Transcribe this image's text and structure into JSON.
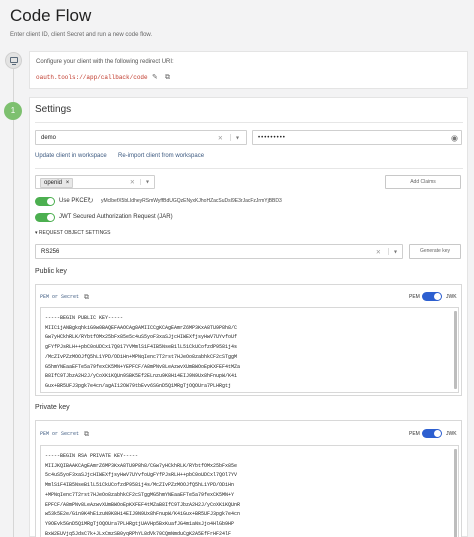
{
  "page": {
    "title": "Code Flow",
    "subtitle": "Enter client ID, client Secret and run a new code flow."
  },
  "redirect": {
    "label": "Configure your client with the following redirect URI:",
    "uri": "oauth.tools://app/callback/code"
  },
  "step2": {
    "number": "1"
  },
  "settings": {
    "title": "Settings",
    "client_id": "demo",
    "client_secret_masked": "•••••••••",
    "update_link": "Update client in workspace",
    "reimport_link": "Re-import client from workspace",
    "scope_chip": "openid",
    "add_claims_label": "Add Claims",
    "use_pkce_label": "Use PKCE",
    "pkce_value": "yMclbefX5bLIdheyRSmWyffBdUGQzENyxKJhoHZacSuDsI9E3rJacFzJrmYjBBD3",
    "jar_label": "JWT Secured Authorization Request (JAR)",
    "request_object_settings": "REQUEST OBJECT SETTINGS",
    "algorithm": "RS256",
    "generate_key_label": "Generate key"
  },
  "public_key": {
    "label": "Public key",
    "format_label": "PEM or Secret",
    "pem_label": "PEM",
    "jwk_label": "JWK",
    "lines": [
      "-----BEGIN PUBLIC KEY-----",
      "MIIC1jANBgkqhkiG9w0BAQEFAAOCAg8AMIICCgKCAgEAmrZ6MP3KxA8TU9P8h8/C",
      "Gw7yHCkhRLK/RYbtfOMx25bFx85e5c4uS5yoF3xaSJjcHIWEXfjsyHwV7UYvfoUf",
      "gFYfPJsRLH++pbC0oUDCx17Q017YVMmlS1F4IB5NseB1lL51CkUCofzdP9581j4s",
      "/McZIvPZzMOOJfQ5hL1YPD/ODiHn+MPNqIenc7T2rst7HJeOo8zabhkCF2cSTggM",
      "G5hmYNEaaEFTe5a79fexCK5MN+YEPFCF/A8mPNv8LeAzwvXUmBWOoEpKXFEF4tMZa",
      "B8IfC9TJbzA2H2J/yCoXK1KQUn9SBK5Ef2ELnzu9K8Hi4EIJ9N9Ux8hFnupW/K4i",
      "Gux+BR5UFJ3pgk7e4cn/agAI12OW79tbEvv6SGnD5Q1MRgTjOQOUra7PLHRgtj",
      "AVHp5BxKuafJG4m1aNsJjo4HlGb9HP5Bxw2EUVjq5JdsC7k+JLxCmzSB0yqRPhYL",
      "8dVk70CQmNmduCgK2A5EfFrHF24lF+TAAn1e/Ks3/TK3NrFV1MEGS3fHqJBaQFDH"
    ]
  },
  "private_key": {
    "label": "Private key",
    "format_label": "PEM or Secret",
    "pem_label": "PEM",
    "jwk_label": "JWK",
    "lines": [
      "-----BEGIN RSA PRIVATE KEY-----",
      "MIIJKQIBAAKCAgEAmrZ6MP3KxA8TU9P8h8/CGw7yHCkhRLK/RYbtfOMx25bFx85e",
      "5c4uS5yoF3xaSJjcHIWEXfjsyHwV7UYvfoUgFYfPJsRLH++pbC0oUDCxl7QOl7YV",
      "MmlS1F4IB5NseB1lL51CkUCofzdP9581j4s/McZIvPZzMOOJfQ5hL1YPD/ODiHn",
      "+MPNqIenc7T2rst7HJeOo8zabhkCF2cSTggMG5hmYNEaaEFTe5a79fexCK5MN+Y",
      "EPFCF/A8mPNv8LeAzwvXUmBWOoEpKXFEF4tMZaB8IfC9TJbzA2H2J/yCoXK1KQUnR",
      "w53k5E2e/G1n9K4hE1zuN9K8Hi4EIJ9N9Ux8hFnupW/K4iGux+BR5UFJ3pgk7e4cn",
      "Y9OEvk5GnD5Q1MRgTjOQOUra7PLHRgtjUAVHp5BxKuafJG4m1aNsJjo4HlGb9HP",
      "BxW2EUVjq5JdsC7k+JLxCmzSB0yqRPhYL8dVk70CQmNmduCgK2A5EfFrHF24lF",
      "+TAAn1e/Ks3/TK3NrFV1MEGS3fHqJBaQFDHaPFAKTlR3dKksZz9ESZNZ6/LsaLGfbx"
    ]
  }
}
